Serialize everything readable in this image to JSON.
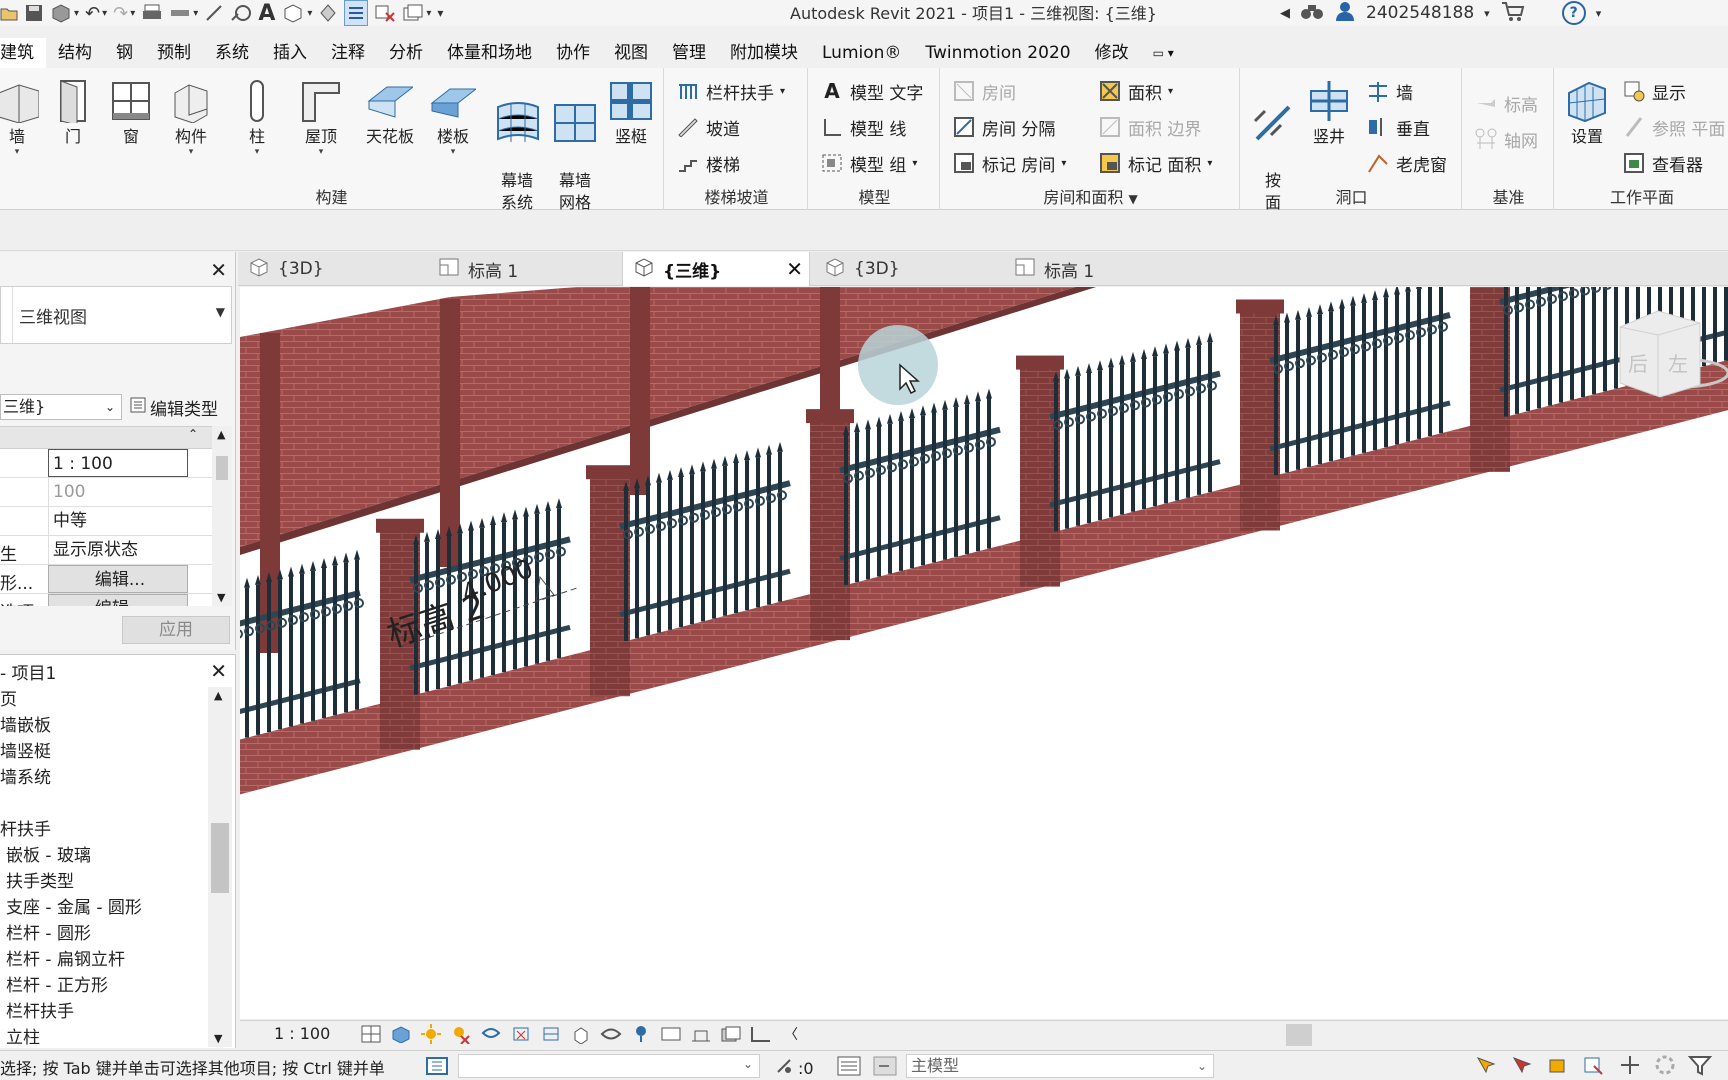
{
  "titlebar": {
    "title": "Autodesk Revit 2021 - 项目1 - 三维视图: {三维}",
    "user_id": "2402548188",
    "help": "?"
  },
  "ribbon_tabs": [
    "建筑",
    "结构",
    "钢",
    "预制",
    "系统",
    "插入",
    "注释",
    "分析",
    "体量和场地",
    "协作",
    "视图",
    "管理",
    "附加模块",
    "Lumion®",
    "Twinmotion 2020",
    "修改"
  ],
  "ribbon": {
    "build": {
      "label": "构建",
      "buttons": [
        {
          "label": "墙",
          "icon": "wall-icon"
        },
        {
          "label": "门",
          "icon": "door-icon"
        },
        {
          "label": "窗",
          "icon": "window-icon"
        },
        {
          "label": "构件",
          "icon": "component-icon"
        },
        {
          "label": "柱",
          "icon": "column-icon"
        },
        {
          "label": "屋顶",
          "icon": "roof-icon"
        },
        {
          "label": "天花板",
          "icon": "ceiling-icon"
        },
        {
          "label": "楼板",
          "icon": "floor-icon"
        },
        {
          "label": "幕墙\n系统",
          "icon": "curtain-system-icon"
        },
        {
          "label": "幕墙\n网格",
          "icon": "curtain-grid-icon"
        },
        {
          "label": "竖梃",
          "icon": "mullion-icon"
        }
      ]
    },
    "stairs": {
      "label": "楼梯坡道",
      "items": [
        "栏杆扶手",
        "坡道",
        "楼梯"
      ]
    },
    "model": {
      "label": "模型",
      "items": [
        "模型 文字",
        "模型 线",
        "模型 组"
      ]
    },
    "rooms": {
      "label": "房间和面积",
      "items": [
        "房间",
        "房间 分隔",
        "标记 房间",
        "面积",
        "面积 边界",
        "标记 面积"
      ]
    },
    "openings": {
      "label": "洞口",
      "big": [
        "按\n面",
        "竖井"
      ],
      "items": [
        "墙",
        "垂直",
        "老虎窗"
      ]
    },
    "datum": {
      "label": "基准",
      "items": [
        "标高",
        "轴网"
      ]
    },
    "workplane": {
      "label": "工作平面",
      "big": "设置",
      "items": [
        "显示",
        "参照 平面",
        "查看器"
      ]
    }
  },
  "properties": {
    "type_name": "三维视图",
    "instance_selector": "三维}",
    "edit_type": "编辑类型",
    "rows": [
      {
        "key": "",
        "value": "1 : 100"
      },
      {
        "key": "",
        "value": "100"
      },
      {
        "key": "",
        "value": "中等"
      },
      {
        "key": "生",
        "value": "显示原状态"
      },
      {
        "key": "形...",
        "value": "编辑..."
      },
      {
        "key": "选项",
        "value": "编辑..."
      }
    ],
    "apply": "应用"
  },
  "browser": {
    "title": "- 项目1",
    "items": [
      "页",
      "墙嵌板",
      "墙竖梃",
      "墙系统",
      "",
      "杆扶手",
      "嵌板 - 玻璃",
      "扶手类型",
      "支座 - 金属 - 圆形",
      "栏杆 - 圆形",
      "栏杆 - 扁钢立杆",
      "栏杆 - 正方形",
      "栏杆扶手",
      "立柱"
    ]
  },
  "view_tabs": [
    {
      "label": "{3D}",
      "icon": "3d-view-icon"
    },
    {
      "label": "标高 1",
      "icon": "plan-view-icon"
    },
    {
      "label": "{三维}",
      "icon": "3d-view-icon",
      "active": true
    },
    {
      "label": "{3D}",
      "icon": "3d-view-icon"
    },
    {
      "label": "标高 1",
      "icon": "plan-view-icon"
    }
  ],
  "canvas": {
    "level_tag": "标高 2",
    "level_value": "4.000",
    "viewcube_faces": [
      "后",
      "左"
    ],
    "colors": {
      "brick": "#9a4a48",
      "brick_dark": "#7e3a39",
      "rail": "#2e4654",
      "cursor_halo": "#b9d3d8"
    }
  },
  "viewbar": {
    "scale": "1 : 100"
  },
  "statusbar": {
    "text": "选择; 按 Tab 键并单击可选择其他项目; 按 Ctrl 键并单",
    "selection_count": ":0",
    "active_model": "主模型"
  }
}
